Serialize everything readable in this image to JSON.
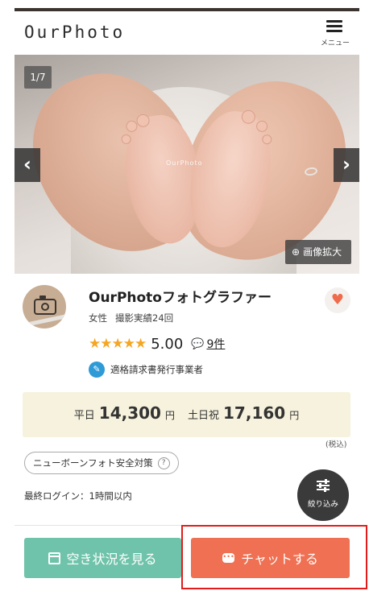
{
  "header": {
    "logo": "OurPhoto",
    "menu_label": "メニュー"
  },
  "gallery": {
    "counter": "1/7",
    "prev_arrow": "‹",
    "next_arrow": "›",
    "zoom_label": "画像拡大",
    "watermark": "OurPhoto"
  },
  "profile": {
    "name": "OurPhotoフォトグラファー",
    "gender": "女性",
    "shoot_record": "撮影実績24回",
    "stars": "★★★★★",
    "score": "5.00",
    "review_count": "9件",
    "invoice_label": "適格請求書発行事業者"
  },
  "price": {
    "weekday_label": "平日",
    "weekday_value": "14,300",
    "weekend_label": "土日祝",
    "weekend_value": "17,160",
    "unit": "円",
    "tax_note": "(税込)"
  },
  "tag": {
    "label": "ニューボーンフォト安全対策",
    "help": "?"
  },
  "last_login": "最終ログイン：1時間以内",
  "filter": {
    "label": "絞り込み"
  },
  "actions": {
    "availability_label": "空き状況を見る",
    "chat_label": "チャットする"
  },
  "colors": {
    "availability_button": "#6fc3aa",
    "chat_button": "#ef7052",
    "price_bg": "#f6f2dd",
    "star": "#f5a623",
    "highlight": "#e31b1b"
  }
}
